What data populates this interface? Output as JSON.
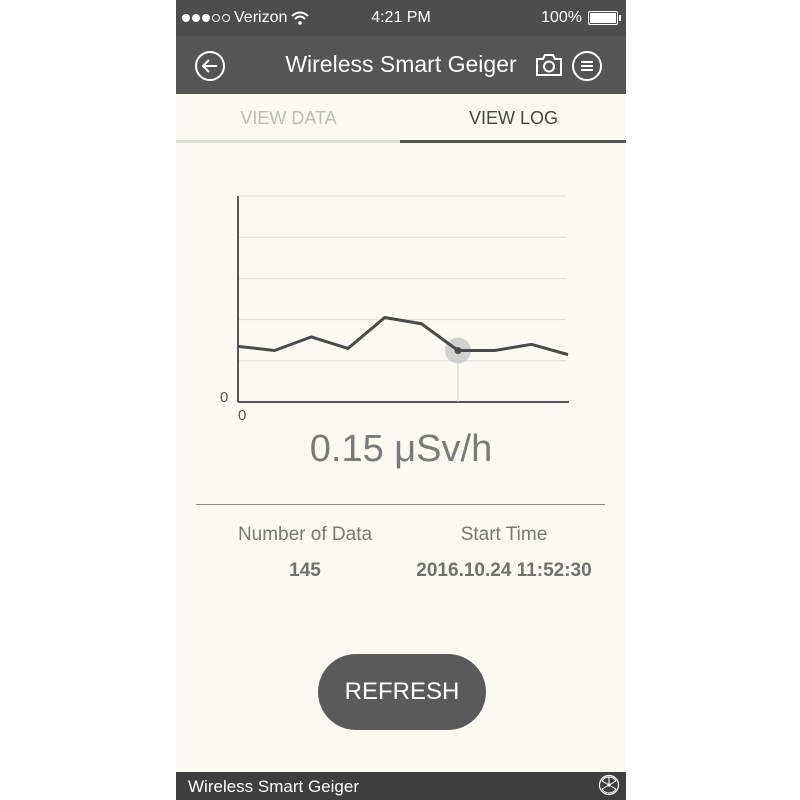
{
  "status_bar": {
    "carrier": "Verizon",
    "time": "4:21 PM",
    "battery": "100%"
  },
  "navbar": {
    "title": "Wireless Smart Geiger",
    "back_icon": "back-arrow-icon",
    "camera_icon": "camera-icon",
    "menu_icon": "menu-icon"
  },
  "tabs": [
    {
      "label": "VIEW DATA",
      "active": false
    },
    {
      "label": "VIEW LOG",
      "active": true
    }
  ],
  "chart_data": {
    "type": "line",
    "y_tick_label": "0",
    "x_tick_label": "0",
    "grid": true,
    "values": [
      0.135,
      0.125,
      0.158,
      0.13,
      0.205,
      0.19,
      0.125,
      0.125,
      0.14,
      0.115
    ],
    "ylim": [
      0,
      0.5
    ],
    "highlight_index": 6,
    "line_color": "#4a4a4a"
  },
  "reading": "0.15 μSv/h",
  "stats": {
    "count_label": "Number of Data",
    "count_value": "145",
    "start_label": "Start Time",
    "start_value": "2016.10.24 11:52:30"
  },
  "refresh_label": "REFRESH",
  "footer": {
    "title": "Wireless Smart Geiger",
    "icon": "radiation-icon"
  }
}
